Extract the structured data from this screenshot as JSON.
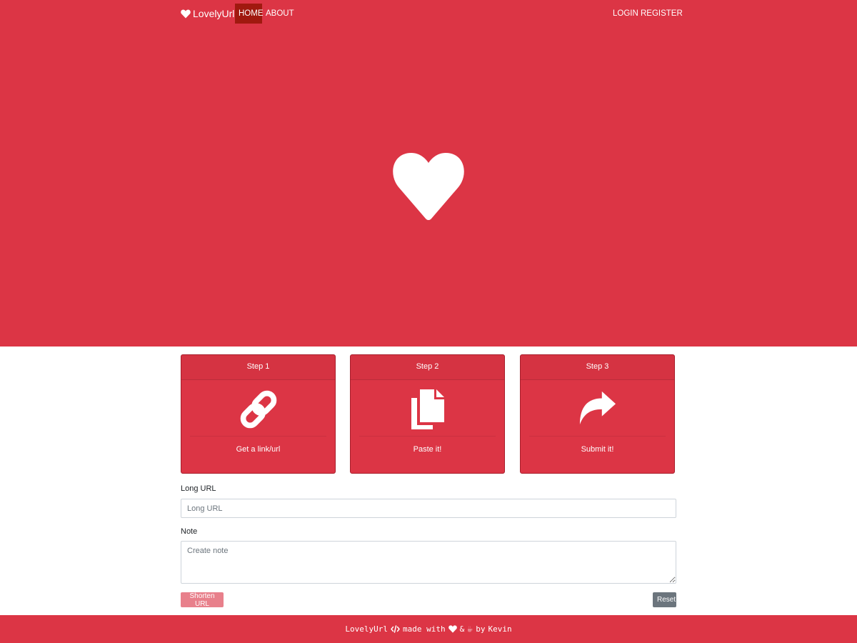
{
  "navbar": {
    "brand": "LovelyUrl",
    "links": {
      "home": "HOME",
      "about": "ABOUT",
      "login": "LOGIN",
      "register": "REGISTER"
    },
    "active": "HOME"
  },
  "steps": [
    {
      "title": "Step 1",
      "text": "Get a link/url",
      "icon": "link-icon"
    },
    {
      "title": "Step 2",
      "text": "Paste it!",
      "icon": "copy-icon"
    },
    {
      "title": "Step 3",
      "text": "Submit it!",
      "icon": "share-icon"
    }
  ],
  "form": {
    "long_url_label": "Long URL",
    "long_url_placeholder": "Long URL",
    "note_label": "Note",
    "note_placeholder": "Create note",
    "shorten_label": "Shorten URL",
    "reset_label": "Reset"
  },
  "footer": {
    "brand": "LovelyUrl",
    "made_with": "made with",
    "amp": "&",
    "by": "by",
    "author": "Kevin"
  },
  "colors": {
    "primary": "#dc3545",
    "nav_active": "#a0190f",
    "disabled_button": "#e8808b",
    "secondary": "#6c757d"
  }
}
